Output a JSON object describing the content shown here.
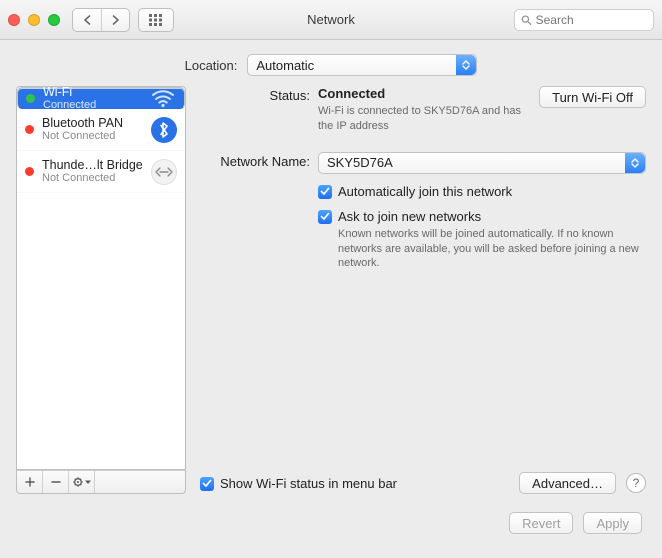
{
  "window": {
    "title": "Network"
  },
  "toolbar": {
    "search_placeholder": "Search"
  },
  "location": {
    "label": "Location:",
    "value": "Automatic"
  },
  "sidebar": {
    "items": [
      {
        "name": "Wi-Fi",
        "status_text": "Connected",
        "status": "green",
        "icon": "wifi"
      },
      {
        "name": "Bluetooth PAN",
        "status_text": "Not Connected",
        "status": "red",
        "icon": "bluetooth"
      },
      {
        "name": "Thunde…lt Bridge",
        "status_text": "Not Connected",
        "status": "red",
        "icon": "thunderbolt"
      }
    ]
  },
  "panel": {
    "status_label": "Status:",
    "status_value": "Connected",
    "status_desc": "Wi-Fi is connected to SKY5D76A and has the IP address",
    "turn_off": "Turn Wi-Fi Off",
    "network_name_label": "Network Name:",
    "network_name_value": "SKY5D76A",
    "auto_join": "Automatically join this network",
    "ask_join": "Ask to join new networks",
    "ask_join_desc": "Known networks will be joined automatically. If no known networks are available, you will be asked before joining a new network.",
    "show_menu": "Show Wi-Fi status in menu bar",
    "advanced": "Advanced…"
  },
  "footer": {
    "revert": "Revert",
    "apply": "Apply"
  }
}
